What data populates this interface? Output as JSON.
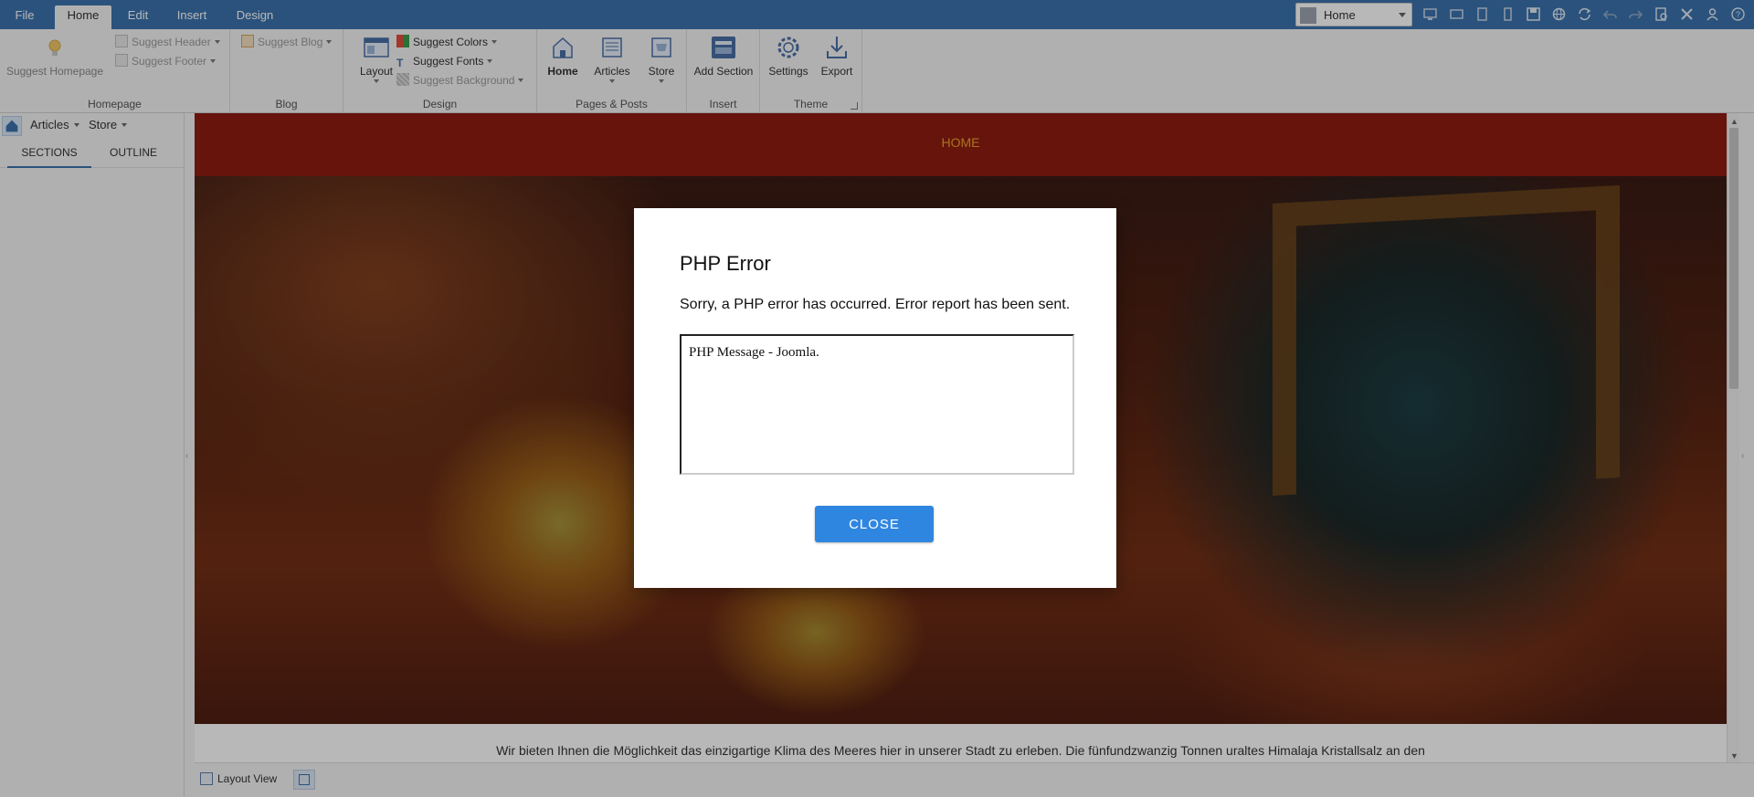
{
  "menubar": {
    "tabs": [
      {
        "label": "File"
      },
      {
        "label": "Home"
      },
      {
        "label": "Edit"
      },
      {
        "label": "Insert"
      },
      {
        "label": "Design"
      }
    ],
    "active_tab": "Home",
    "page_select": {
      "value": "Home"
    },
    "quick_access_icons": [
      "desktop-view-icon",
      "tablet-landscape-icon",
      "tablet-portrait-icon",
      "phone-icon",
      "save-icon",
      "globe-icon",
      "refresh-icon",
      "undo-icon",
      "redo-icon",
      "preview-icon",
      "tools-icon",
      "user-icon",
      "help-icon"
    ]
  },
  "ribbon": {
    "homepage": {
      "suggest_homepage": "Suggest Homepage",
      "suggest_header": "Suggest Header",
      "suggest_footer": "Suggest Footer",
      "label": "Homepage"
    },
    "blog": {
      "suggest_blog": "Suggest Blog",
      "label": "Blog"
    },
    "design": {
      "layout": "Layout",
      "suggest_colors": "Suggest Colors",
      "suggest_fonts": "Suggest Fonts",
      "suggest_background": "Suggest Background",
      "label": "Design"
    },
    "pages_posts": {
      "home": "Home",
      "articles": "Articles",
      "store": "Store",
      "label": "Pages & Posts"
    },
    "insert": {
      "add_section": "Add Section",
      "label": "Insert"
    },
    "theme": {
      "settings": "Settings",
      "export": "Export",
      "label": "Theme"
    }
  },
  "leftpanel": {
    "breadcrumb": [
      "Articles",
      "Store"
    ],
    "tabs": [
      {
        "label": "SECTIONS"
      },
      {
        "label": "OUTLINE"
      }
    ],
    "active_tab": "SECTIONS"
  },
  "site": {
    "nav_item": "HOME",
    "intro_text": "Wir bieten Ihnen die Möglichkeit das einzigartige Klima des Meeres hier in unserer Stadt zu erleben. Die fünfundzwanzig Tonnen uraltes Himalaja Kristallsalz an den"
  },
  "bottombar": {
    "layout_view": "Layout View"
  },
  "dialog": {
    "title": "PHP Error",
    "message": "Sorry, a PHP error has occurred. Error report has been sent.",
    "details": "PHP Message - Joomla.",
    "close_label": "CLOSE"
  },
  "colors": {
    "menubar": "#3b72ad",
    "site_header": "#8e1d11",
    "nav_text": "#e9a22d",
    "close_button": "#2f86e0"
  }
}
